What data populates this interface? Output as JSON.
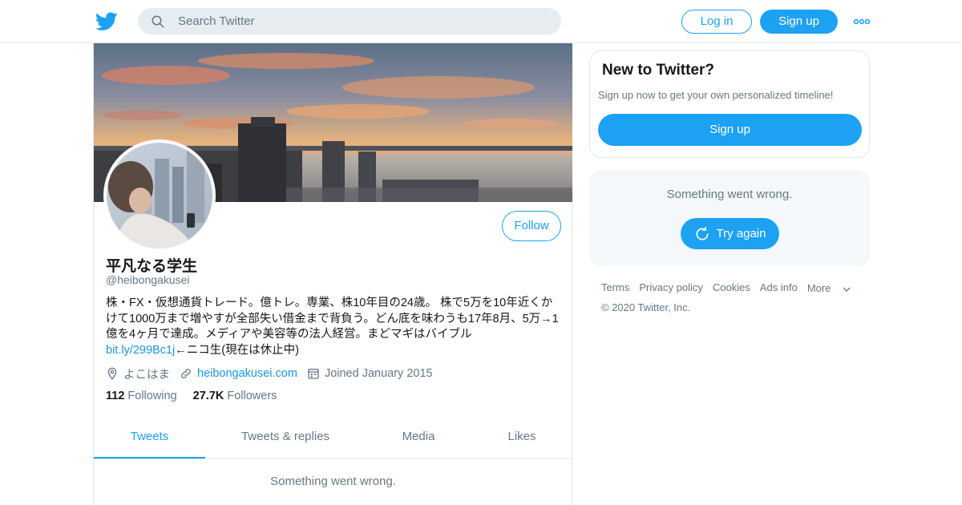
{
  "header": {
    "logo_icon": "twitter-bird-icon",
    "search_placeholder": "Search Twitter",
    "login_label": "Log in",
    "signup_label": "Sign up",
    "more_icon": "more-dots-icon",
    "accent_color": "#1da1f2"
  },
  "profile": {
    "display_name": "平凡なる学生",
    "handle": "@heibongakusei",
    "follow_label": "Follow",
    "bio_text": "株・FX・仮想通貨トレード。億トレ。専業、株10年目の24歳。 株で5万を10年近くかけて1000万まで増やすが全部失い借金まで背負う。どん底を味わうも17年8月、5万→1億を4ヶ月で達成。メディアや美容等の法人経営。まどマギはバイブル",
    "bio_link": "bit.ly/299Bc1j",
    "bio_suffix": "←ニコ生(現在は休止中)",
    "location": "よこはま",
    "website": "heibongakusei.com",
    "joined": "Joined January 2015",
    "following_count": "112",
    "following_label": "Following",
    "followers_count": "27.7K",
    "followers_label": "Followers"
  },
  "tabs": [
    {
      "label": "Tweets",
      "active": true
    },
    {
      "label": "Tweets & replies",
      "active": false
    },
    {
      "label": "Media",
      "active": false
    },
    {
      "label": "Likes",
      "active": false
    }
  ],
  "feed": {
    "error_message": "Something went wrong."
  },
  "sidebar": {
    "signup_card": {
      "title": "New to Twitter?",
      "subtitle": "Sign up now to get your own personalized timeline!",
      "button_label": "Sign up"
    },
    "error_card": {
      "message": "Something went wrong.",
      "retry_label": "Try again"
    },
    "footer": {
      "links": [
        "Terms",
        "Privacy policy",
        "Cookies",
        "Ads info",
        "More"
      ],
      "copyright": "© 2020 Twitter, Inc."
    }
  }
}
